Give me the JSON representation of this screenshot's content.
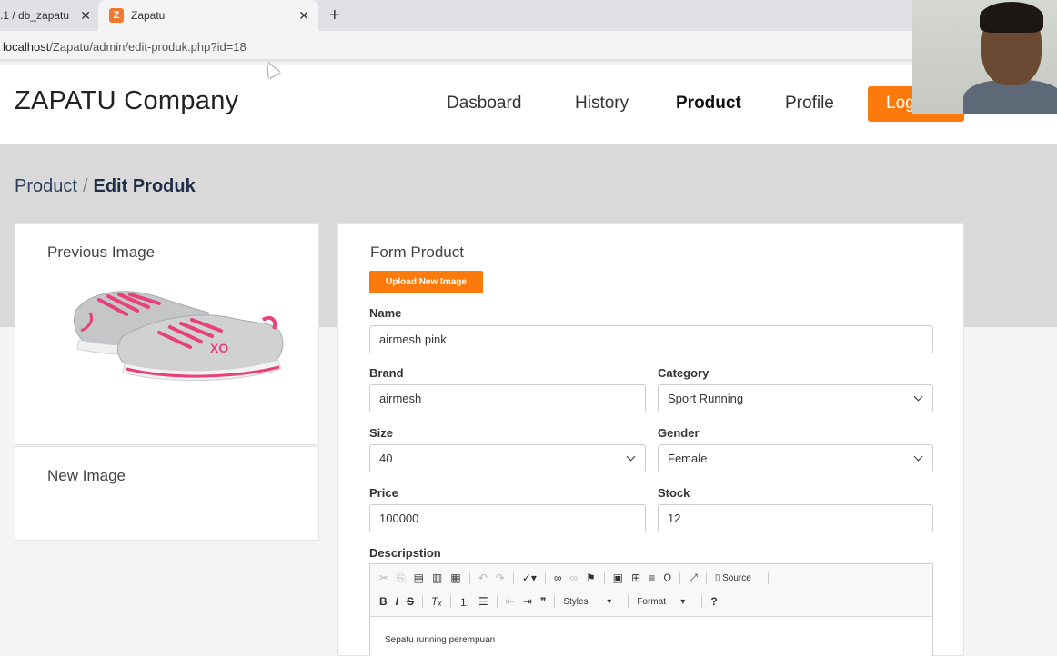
{
  "browser": {
    "tab_inactive": ".1 / db_zapatu",
    "tab_active": "Zapatu",
    "tab_close_glyph": "✕",
    "favicon_letter": "Z",
    "new_tab_glyph": "+",
    "url_host": "localhost",
    "url_path": "/Zapatu/admin/edit-produk.php?id=18"
  },
  "header": {
    "brand": "ZAPATU Company",
    "nav": [
      "Dasboard",
      "History",
      "Product",
      "Profile"
    ],
    "active_nav": "Product",
    "logout_label": "Log"
  },
  "breadcrumb": {
    "parent": "Product",
    "separator": "/",
    "current": "Edit Produk"
  },
  "images": {
    "previous_title": "Previous Image",
    "new_title": "New Image"
  },
  "form": {
    "title": "Form Product",
    "upload_label": "Upload New Image",
    "name_label": "Name",
    "name_value": "airmesh pink",
    "brand_label": "Brand",
    "brand_value": "airmesh",
    "category_label": "Category",
    "category_value": "Sport Running",
    "size_label": "Size",
    "size_value": "40",
    "gender_label": "Gender",
    "gender_value": "Female",
    "price_label": "Price",
    "price_value": "100000",
    "stock_label": "Stock",
    "stock_value": "12",
    "description_label": "Descripstion",
    "description_value": "Sepatu running perempuan"
  },
  "editor": {
    "source_label": "Source",
    "styles_label": "Styles",
    "format_label": "Format",
    "bold": "B",
    "italic": "I",
    "strike": "S",
    "help": "?"
  },
  "colors": {
    "accent": "#fb7a0b",
    "gray_band": "#d9d9d9",
    "breadcrumb_text": "#1f2d49"
  }
}
